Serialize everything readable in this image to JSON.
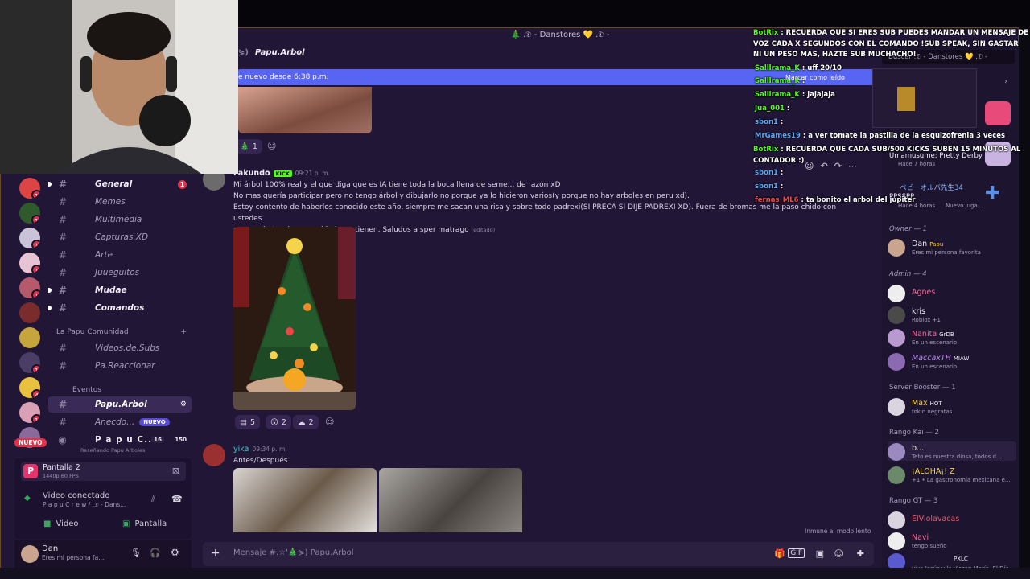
{
  "window": {
    "title": "🎄 .𝔇 - Danstores 💛 .𝔇 -"
  },
  "channel_header": {
    "name": "Papu.Arbol"
  },
  "new_messages_bar": {
    "text": "e nuevo desde 6:38 p.m.",
    "mark_read": "Marcar como leído"
  },
  "rail": {
    "badges": [
      "1",
      "1",
      "1",
      "1",
      "1",
      "1",
      "4",
      "1",
      "6"
    ]
  },
  "channels": [
    {
      "label": "General",
      "bold": true,
      "badge": "1"
    },
    {
      "label": "Memes",
      "bold": false
    },
    {
      "label": "Multimedia",
      "bold": false
    },
    {
      "label": "Capturas.XD",
      "bold": false
    },
    {
      "label": "Arte",
      "bold": false
    },
    {
      "label": "Juueguitos",
      "bold": false
    },
    {
      "label": "Mudae",
      "bold": true
    },
    {
      "label": "Comandos",
      "bold": true
    }
  ],
  "category1": {
    "label": "La Papu Comunidad"
  },
  "channels2": [
    {
      "label": "Videos.de.Subs"
    },
    {
      "label": "Pa.Reaccionar"
    }
  ],
  "category2": {
    "label": "Eventos"
  },
  "channels3": [
    {
      "label": "Papu.Arbol",
      "selected": true
    },
    {
      "label": "Anecdo...",
      "tag": "NUEVO"
    }
  ],
  "voice_channel": {
    "name": "P a p u C...",
    "count1": "16",
    "count2": "150",
    "sub": "Reseñando Papu Arboles"
  },
  "nuevo_badge": "NUEVO",
  "voice_panel": {
    "stream_title": "Pantalla 2",
    "stream_sub": "1440p 60 FPS",
    "status": "Video conectado",
    "server": "P a p u C r e w / .𝔇 - Dans...",
    "video_label": "Video",
    "screen_label": "Pantalla"
  },
  "user": {
    "name": "Dan",
    "status": "Eres mi persona fa..."
  },
  "messages": [
    {
      "reaction_count": "1"
    },
    {
      "author": "Fakundo",
      "tag": "KICK",
      "time": "09:21 p. m.",
      "lines": [
        "Mi árbol 100% real y el que diga que es IA tiene toda la boca llena de seme... de razón xD",
        "No mas quería participar pero no tengo árbol y dibujarlo no porque ya lo hicieron varios(y porque no hay arboles en peru xd).",
        "Estoy contento de haberlos conocido este año, siempre me sacan una risa y sobre todo padrexi(SI PRECA SI DIJE PADREXI XD). Fuera de bromas me la paso chido con ustedes",
        "en sus chats y la comunidad que tienen. Saludos a sper matrago"
      ],
      "edited": "(editado)",
      "reactions": [
        "5",
        "2",
        "2"
      ]
    },
    {
      "author": "yika",
      "time": "09:34 p. m.",
      "text": "Antes/Después"
    }
  ],
  "slowmode": "Inmune al modo lento",
  "input": {
    "placeholder": "Mensaje #.☆'🎄⋟) Papu.Arbol"
  },
  "members": {
    "search_placeholder": "Buscar .𝔇 - Danstores 💛 .𝔇 -",
    "activity1": {
      "name": "Umamusume: Pretty Derby",
      "time": "Hace 7 horas"
    },
    "activity2": {
      "name": "ベビーオルバ先生34",
      "sub": "PPSSPP",
      "time": "Hace 4 horas",
      "extra": "Nuevo juga..."
    },
    "owner_header": "Owner — 1",
    "owner": {
      "name": "Dan",
      "tag": "Papu",
      "status": "Eres mi persona favorita"
    },
    "admin_header": "Admin — 4",
    "admins": [
      {
        "name": "Agnes",
        "status": ""
      },
      {
        "name": "kris",
        "status": "Roblox +1"
      },
      {
        "name": "Nanita",
        "tag": "GrDB",
        "status": "En un escenario"
      },
      {
        "name": "MaccaxTH",
        "tag": "MIAW",
        "status": "En un escenario"
      }
    ],
    "booster_header": "Server Booster — 1",
    "booster": {
      "name": "Max",
      "tag": "HOT",
      "status": "fokin negratas"
    },
    "kai_header": "Rango Kai — 2",
    "kai": [
      {
        "name": "b...",
        "status": "Teto es nuestra diosa, todos d..."
      },
      {
        "name": "¡ALOHA¡! Z",
        "status": "+1 • La gastronomía mexicana e..."
      }
    ],
    "gt_header": "Rango GT — 3",
    "gt": [
      {
        "name": "ElViolavacas",
        "status": ""
      },
      {
        "name": "Navi",
        "status": "tengo sueño"
      },
      {
        "name": "PXLC",
        "status": "viva Jesús y la Virgen María. El Día..."
      }
    ]
  },
  "kick_chat": [
    {
      "user": "BotRix",
      "text": "RECUERDA QUE SI ERES SUB PUEDES MANDAR UN MENSAJE DE VOZ CADA X SEGUNDOS CON EL COMANDO !SUB SPEAK, SIN GASTAR NI UN PESO MAS, HAZTE SUB MUCHACHO!"
    },
    {
      "user": "Salllrama_K",
      "text": "uff 20/10"
    },
    {
      "user": "Salllrama_K",
      "text": ""
    },
    {
      "user": "Salllrama_K",
      "text": "jajajaja"
    },
    {
      "user": "Jua_001",
      "text": ""
    },
    {
      "user": "sbon1",
      "text": ""
    },
    {
      "user": "MrGames19",
      "text": "a ver tomate la pastilla de la esquizofrenia 3 veces"
    },
    {
      "user": "BotRix",
      "text": "RECUERDA QUE CADA SUB/500 KICKS SUBEN 15 MINUTOS AL CONTADOR :)"
    },
    {
      "user": "sbon1",
      "text": ""
    },
    {
      "user": "sbon1",
      "text": ""
    },
    {
      "user": "fernas_ML6",
      "text": "ta bonito el arbol del jupiter"
    }
  ]
}
